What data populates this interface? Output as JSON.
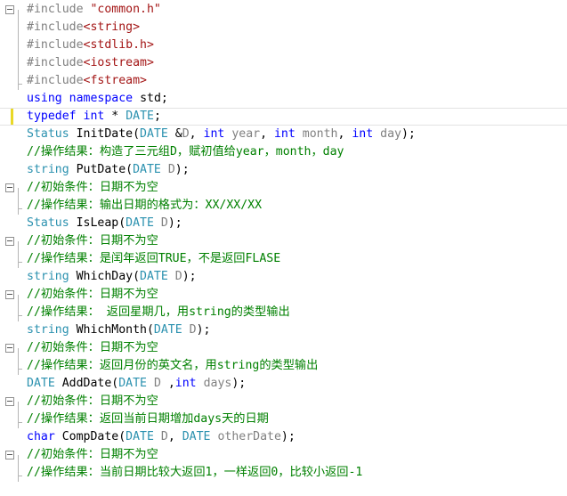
{
  "editor": {
    "lines": [
      {
        "folded": true,
        "guide": "start",
        "marker": false,
        "current": false,
        "tokens": [
          {
            "t": "#include ",
            "c": "pp"
          },
          {
            "t": "\"common.h\"",
            "c": "str"
          }
        ]
      },
      {
        "folded": false,
        "guide": "mid",
        "marker": false,
        "current": false,
        "tokens": [
          {
            "t": "#include",
            "c": "pp"
          },
          {
            "t": "<string>",
            "c": "str"
          }
        ]
      },
      {
        "folded": false,
        "guide": "mid",
        "marker": false,
        "current": false,
        "tokens": [
          {
            "t": "#include",
            "c": "pp"
          },
          {
            "t": "<stdlib.h>",
            "c": "str"
          }
        ]
      },
      {
        "folded": false,
        "guide": "mid",
        "marker": false,
        "current": false,
        "tokens": [
          {
            "t": "#include",
            "c": "pp"
          },
          {
            "t": "<iostream>",
            "c": "str"
          }
        ]
      },
      {
        "folded": false,
        "guide": "end",
        "marker": false,
        "current": false,
        "tokens": [
          {
            "t": "#include",
            "c": "pp"
          },
          {
            "t": "<fstream>",
            "c": "str"
          }
        ]
      },
      {
        "folded": false,
        "guide": "none",
        "marker": false,
        "current": false,
        "tokens": [
          {
            "t": "using",
            "c": "kw"
          },
          {
            "t": " ",
            "c": ""
          },
          {
            "t": "namespace",
            "c": "kw"
          },
          {
            "t": " std;",
            "c": ""
          }
        ]
      },
      {
        "folded": false,
        "guide": "none",
        "marker": true,
        "current": true,
        "tokens": [
          {
            "t": "typedef",
            "c": "kw"
          },
          {
            "t": " ",
            "c": ""
          },
          {
            "t": "int",
            "c": "kw"
          },
          {
            "t": " * ",
            "c": ""
          },
          {
            "t": "DATE",
            "c": "ty"
          },
          {
            "t": ";",
            "c": ""
          }
        ]
      },
      {
        "folded": false,
        "guide": "none",
        "marker": false,
        "current": false,
        "tokens": [
          {
            "t": "Status",
            "c": "ty"
          },
          {
            "t": " InitDate(",
            "c": ""
          },
          {
            "t": "DATE",
            "c": "ty"
          },
          {
            "t": " &",
            "c": ""
          },
          {
            "t": "D",
            "c": "prm"
          },
          {
            "t": ", ",
            "c": ""
          },
          {
            "t": "int",
            "c": "kw"
          },
          {
            "t": " ",
            "c": ""
          },
          {
            "t": "year",
            "c": "prm"
          },
          {
            "t": ", ",
            "c": ""
          },
          {
            "t": "int",
            "c": "kw"
          },
          {
            "t": " ",
            "c": ""
          },
          {
            "t": "month",
            "c": "prm"
          },
          {
            "t": ", ",
            "c": ""
          },
          {
            "t": "int",
            "c": "kw"
          },
          {
            "t": " ",
            "c": ""
          },
          {
            "t": "day",
            "c": "prm"
          },
          {
            "t": ");",
            "c": ""
          }
        ]
      },
      {
        "folded": false,
        "guide": "none",
        "marker": false,
        "current": false,
        "tokens": [
          {
            "t": "//操作结果：构造了三元组D，赋初值给year，month，day",
            "c": "cm"
          }
        ]
      },
      {
        "folded": false,
        "guide": "none",
        "marker": false,
        "current": false,
        "tokens": [
          {
            "t": "string",
            "c": "ty"
          },
          {
            "t": " PutDate(",
            "c": ""
          },
          {
            "t": "DATE",
            "c": "ty"
          },
          {
            "t": " ",
            "c": ""
          },
          {
            "t": "D",
            "c": "prm"
          },
          {
            "t": ");",
            "c": ""
          }
        ]
      },
      {
        "folded": true,
        "guide": "start",
        "marker": false,
        "current": false,
        "tokens": [
          {
            "t": "//初始条件：日期不为空",
            "c": "cm"
          }
        ]
      },
      {
        "folded": false,
        "guide": "end",
        "marker": false,
        "current": false,
        "tokens": [
          {
            "t": "//操作结果：输出日期的格式为：XX/XX/XX",
            "c": "cm"
          }
        ]
      },
      {
        "folded": false,
        "guide": "none",
        "marker": false,
        "current": false,
        "tokens": [
          {
            "t": "Status",
            "c": "ty"
          },
          {
            "t": " IsLeap(",
            "c": ""
          },
          {
            "t": "DATE",
            "c": "ty"
          },
          {
            "t": " ",
            "c": ""
          },
          {
            "t": "D",
            "c": "prm"
          },
          {
            "t": ");",
            "c": ""
          }
        ]
      },
      {
        "folded": true,
        "guide": "start",
        "marker": false,
        "current": false,
        "tokens": [
          {
            "t": "//初始条件：日期不为空",
            "c": "cm"
          }
        ]
      },
      {
        "folded": false,
        "guide": "end",
        "marker": false,
        "current": false,
        "tokens": [
          {
            "t": "//操作结果：是闰年返回TRUE，不是返回FLASE",
            "c": "cm"
          }
        ]
      },
      {
        "folded": false,
        "guide": "none",
        "marker": false,
        "current": false,
        "tokens": [
          {
            "t": "string",
            "c": "ty"
          },
          {
            "t": " WhichDay(",
            "c": ""
          },
          {
            "t": "DATE",
            "c": "ty"
          },
          {
            "t": " ",
            "c": ""
          },
          {
            "t": "D",
            "c": "prm"
          },
          {
            "t": ");",
            "c": ""
          }
        ]
      },
      {
        "folded": true,
        "guide": "start",
        "marker": false,
        "current": false,
        "tokens": [
          {
            "t": "//初始条件：日期不为空",
            "c": "cm"
          }
        ]
      },
      {
        "folded": false,
        "guide": "end",
        "marker": false,
        "current": false,
        "tokens": [
          {
            "t": "//操作结果： 返回星期几，用string的类型输出",
            "c": "cm"
          }
        ]
      },
      {
        "folded": false,
        "guide": "none",
        "marker": false,
        "current": false,
        "tokens": [
          {
            "t": "string",
            "c": "ty"
          },
          {
            "t": " WhichMonth(",
            "c": ""
          },
          {
            "t": "DATE",
            "c": "ty"
          },
          {
            "t": " ",
            "c": ""
          },
          {
            "t": "D",
            "c": "prm"
          },
          {
            "t": ");",
            "c": ""
          }
        ]
      },
      {
        "folded": true,
        "guide": "start",
        "marker": false,
        "current": false,
        "tokens": [
          {
            "t": "//初始条件：日期不为空",
            "c": "cm"
          }
        ]
      },
      {
        "folded": false,
        "guide": "end",
        "marker": false,
        "current": false,
        "tokens": [
          {
            "t": "//操作结果：返回月份的英文名，用string的类型输出",
            "c": "cm"
          }
        ]
      },
      {
        "folded": false,
        "guide": "none",
        "marker": false,
        "current": false,
        "tokens": [
          {
            "t": "DATE",
            "c": "ty"
          },
          {
            "t": " AddDate(",
            "c": ""
          },
          {
            "t": "DATE",
            "c": "ty"
          },
          {
            "t": " ",
            "c": ""
          },
          {
            "t": "D",
            "c": "prm"
          },
          {
            "t": " ,",
            "c": ""
          },
          {
            "t": "int",
            "c": "kw"
          },
          {
            "t": " ",
            "c": ""
          },
          {
            "t": "days",
            "c": "prm"
          },
          {
            "t": ");",
            "c": ""
          }
        ]
      },
      {
        "folded": true,
        "guide": "start",
        "marker": false,
        "current": false,
        "tokens": [
          {
            "t": "//初始条件：日期不为空",
            "c": "cm"
          }
        ]
      },
      {
        "folded": false,
        "guide": "end",
        "marker": false,
        "current": false,
        "tokens": [
          {
            "t": "//操作结果：返回当前日期增加days天的日期",
            "c": "cm"
          }
        ]
      },
      {
        "folded": false,
        "guide": "none",
        "marker": false,
        "current": false,
        "tokens": [
          {
            "t": "char",
            "c": "kw"
          },
          {
            "t": " CompDate(",
            "c": ""
          },
          {
            "t": "DATE",
            "c": "ty"
          },
          {
            "t": " ",
            "c": ""
          },
          {
            "t": "D",
            "c": "prm"
          },
          {
            "t": ", ",
            "c": ""
          },
          {
            "t": "DATE",
            "c": "ty"
          },
          {
            "t": " ",
            "c": ""
          },
          {
            "t": "otherDate",
            "c": "prm"
          },
          {
            "t": ");",
            "c": ""
          }
        ]
      },
      {
        "folded": true,
        "guide": "start",
        "marker": false,
        "current": false,
        "tokens": [
          {
            "t": "//初始条件：日期不为空",
            "c": "cm"
          }
        ]
      },
      {
        "folded": false,
        "guide": "end",
        "marker": false,
        "current": false,
        "tokens": [
          {
            "t": "//操作结果：当前日期比较大返回1，一样返回0，比较小返回-1",
            "c": "cm"
          }
        ]
      }
    ]
  }
}
